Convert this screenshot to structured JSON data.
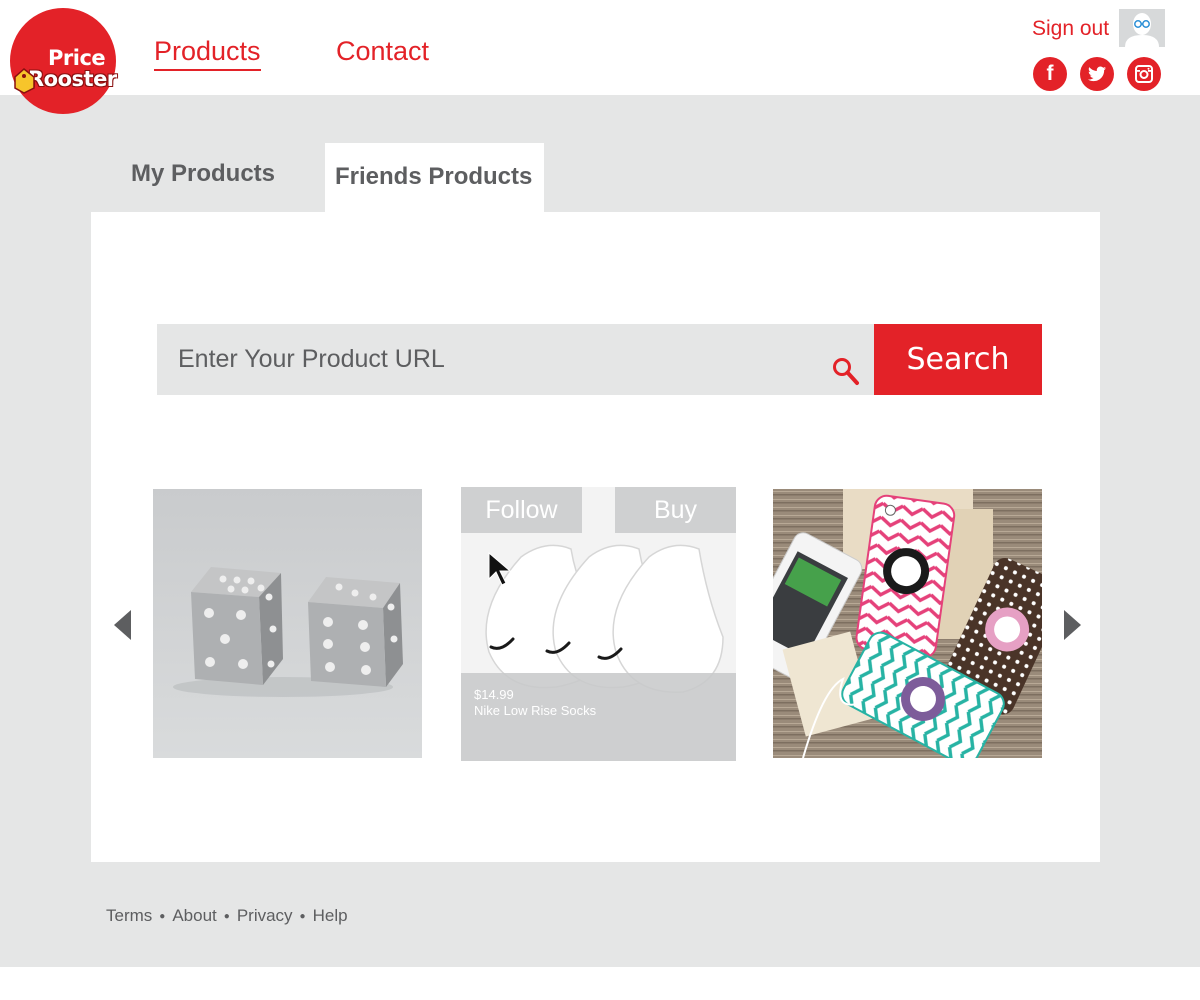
{
  "brand": {
    "line1": "Price",
    "line2": "Rooster",
    "color": "#e32228"
  },
  "nav": {
    "products": "Products",
    "contact": "Contact"
  },
  "user": {
    "sign_out": "Sign out"
  },
  "social": {
    "facebook": "facebook-icon",
    "twitter": "twitter-icon",
    "instagram": "instagram-icon"
  },
  "tabs": {
    "my_products": "My Products",
    "friends_products": "Friends Products",
    "active": "Friends Products"
  },
  "search": {
    "placeholder": "Enter Your Product URL",
    "button": "Search"
  },
  "carousel": {
    "items": [
      {
        "image": "silver dice"
      },
      {
        "image": "white no-show socks",
        "follow": "Follow",
        "buy": "Buy",
        "price": "$14.99",
        "name": "Nike Low Rise Socks"
      },
      {
        "image": "monogram phone cases"
      }
    ]
  },
  "footer": {
    "terms": "Terms",
    "about": "About",
    "privacy": "Privacy",
    "help": "Help"
  },
  "colors": {
    "accent": "#e32228",
    "background": "#e5e6e6",
    "text": "#5d5e60"
  }
}
